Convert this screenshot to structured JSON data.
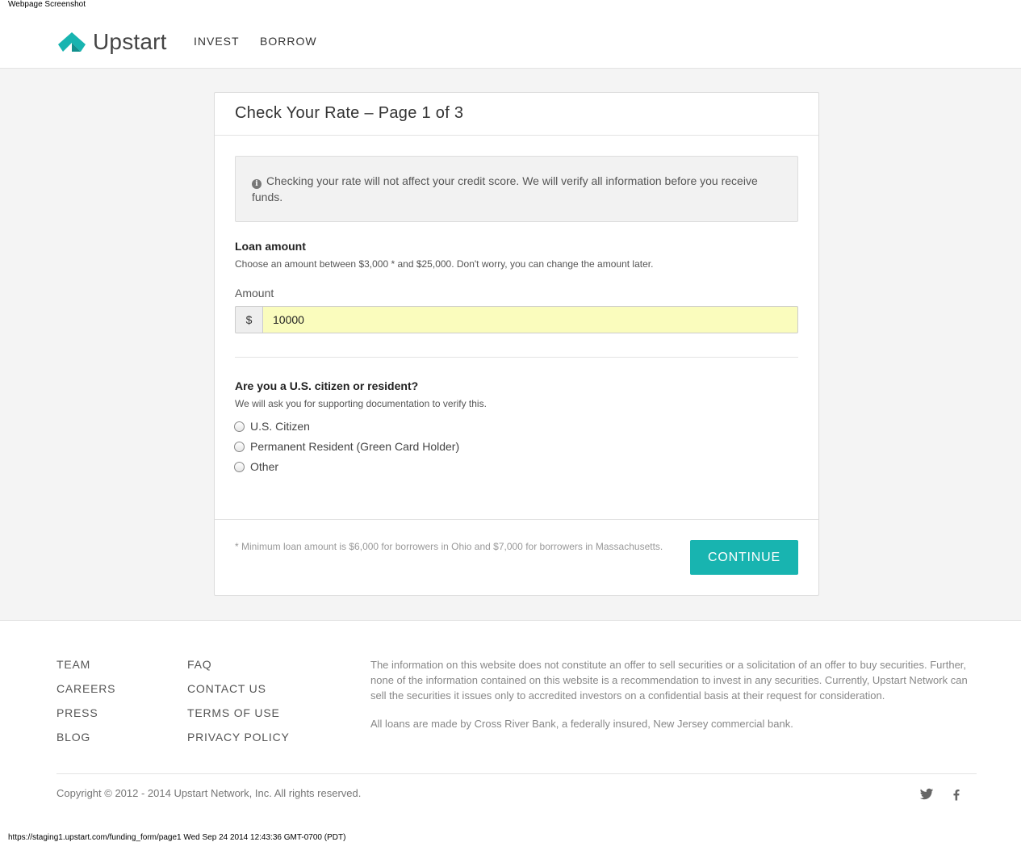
{
  "print": {
    "header": "Webpage Screenshot",
    "footer": "https://staging1.upstart.com/funding_form/page1 Wed Sep 24 2014 12:43:36 GMT-0700 (PDT)"
  },
  "brand": {
    "name": "Upstart",
    "accent_color": "#18b4b0"
  },
  "nav": {
    "invest": "INVEST",
    "borrow": "BORROW"
  },
  "form": {
    "title": "Check Your Rate – Page 1 of 3",
    "notice": "Checking your rate will not affect your credit score. We will verify all information before you receive funds.",
    "notice_icon": "info-icon",
    "loan": {
      "title": "Loan amount",
      "help": "Choose an amount between $3,000 * and $25,000. Don't worry, you can change the amount later.",
      "field_label": "Amount",
      "currency": "$",
      "value": "10000"
    },
    "citizenship": {
      "title": "Are you a U.S. citizen or resident?",
      "help": "We will ask you for supporting documentation to verify this.",
      "options": [
        "U.S. Citizen",
        "Permanent Resident (Green Card Holder)",
        "Other"
      ]
    },
    "footnote": "* Minimum loan amount is $6,000 for borrowers in Ohio and $7,000 for borrowers in Massachusetts.",
    "continue_label": "CONTINUE"
  },
  "footer": {
    "col1": [
      "TEAM",
      "CAREERS",
      "PRESS",
      "BLOG"
    ],
    "col2": [
      "FAQ",
      "CONTACT US",
      "TERMS OF USE",
      "PRIVACY POLICY"
    ],
    "disclaimer1": "The information on this website does not constitute an offer to sell securities or a solicitation of an offer to buy securities. Further, none of the information contained on this website is a recommendation to invest in any securities. Currently, Upstart Network can sell the securities it issues only to accredited investors on a confidential basis at their request for consideration.",
    "disclaimer2": "All loans are made by Cross River Bank, a federally insured, New Jersey commercial bank.",
    "copyright": "Copyright © 2012 - 2014 Upstart Network, Inc. All rights reserved.",
    "social": [
      "twitter-icon",
      "facebook-icon"
    ]
  }
}
